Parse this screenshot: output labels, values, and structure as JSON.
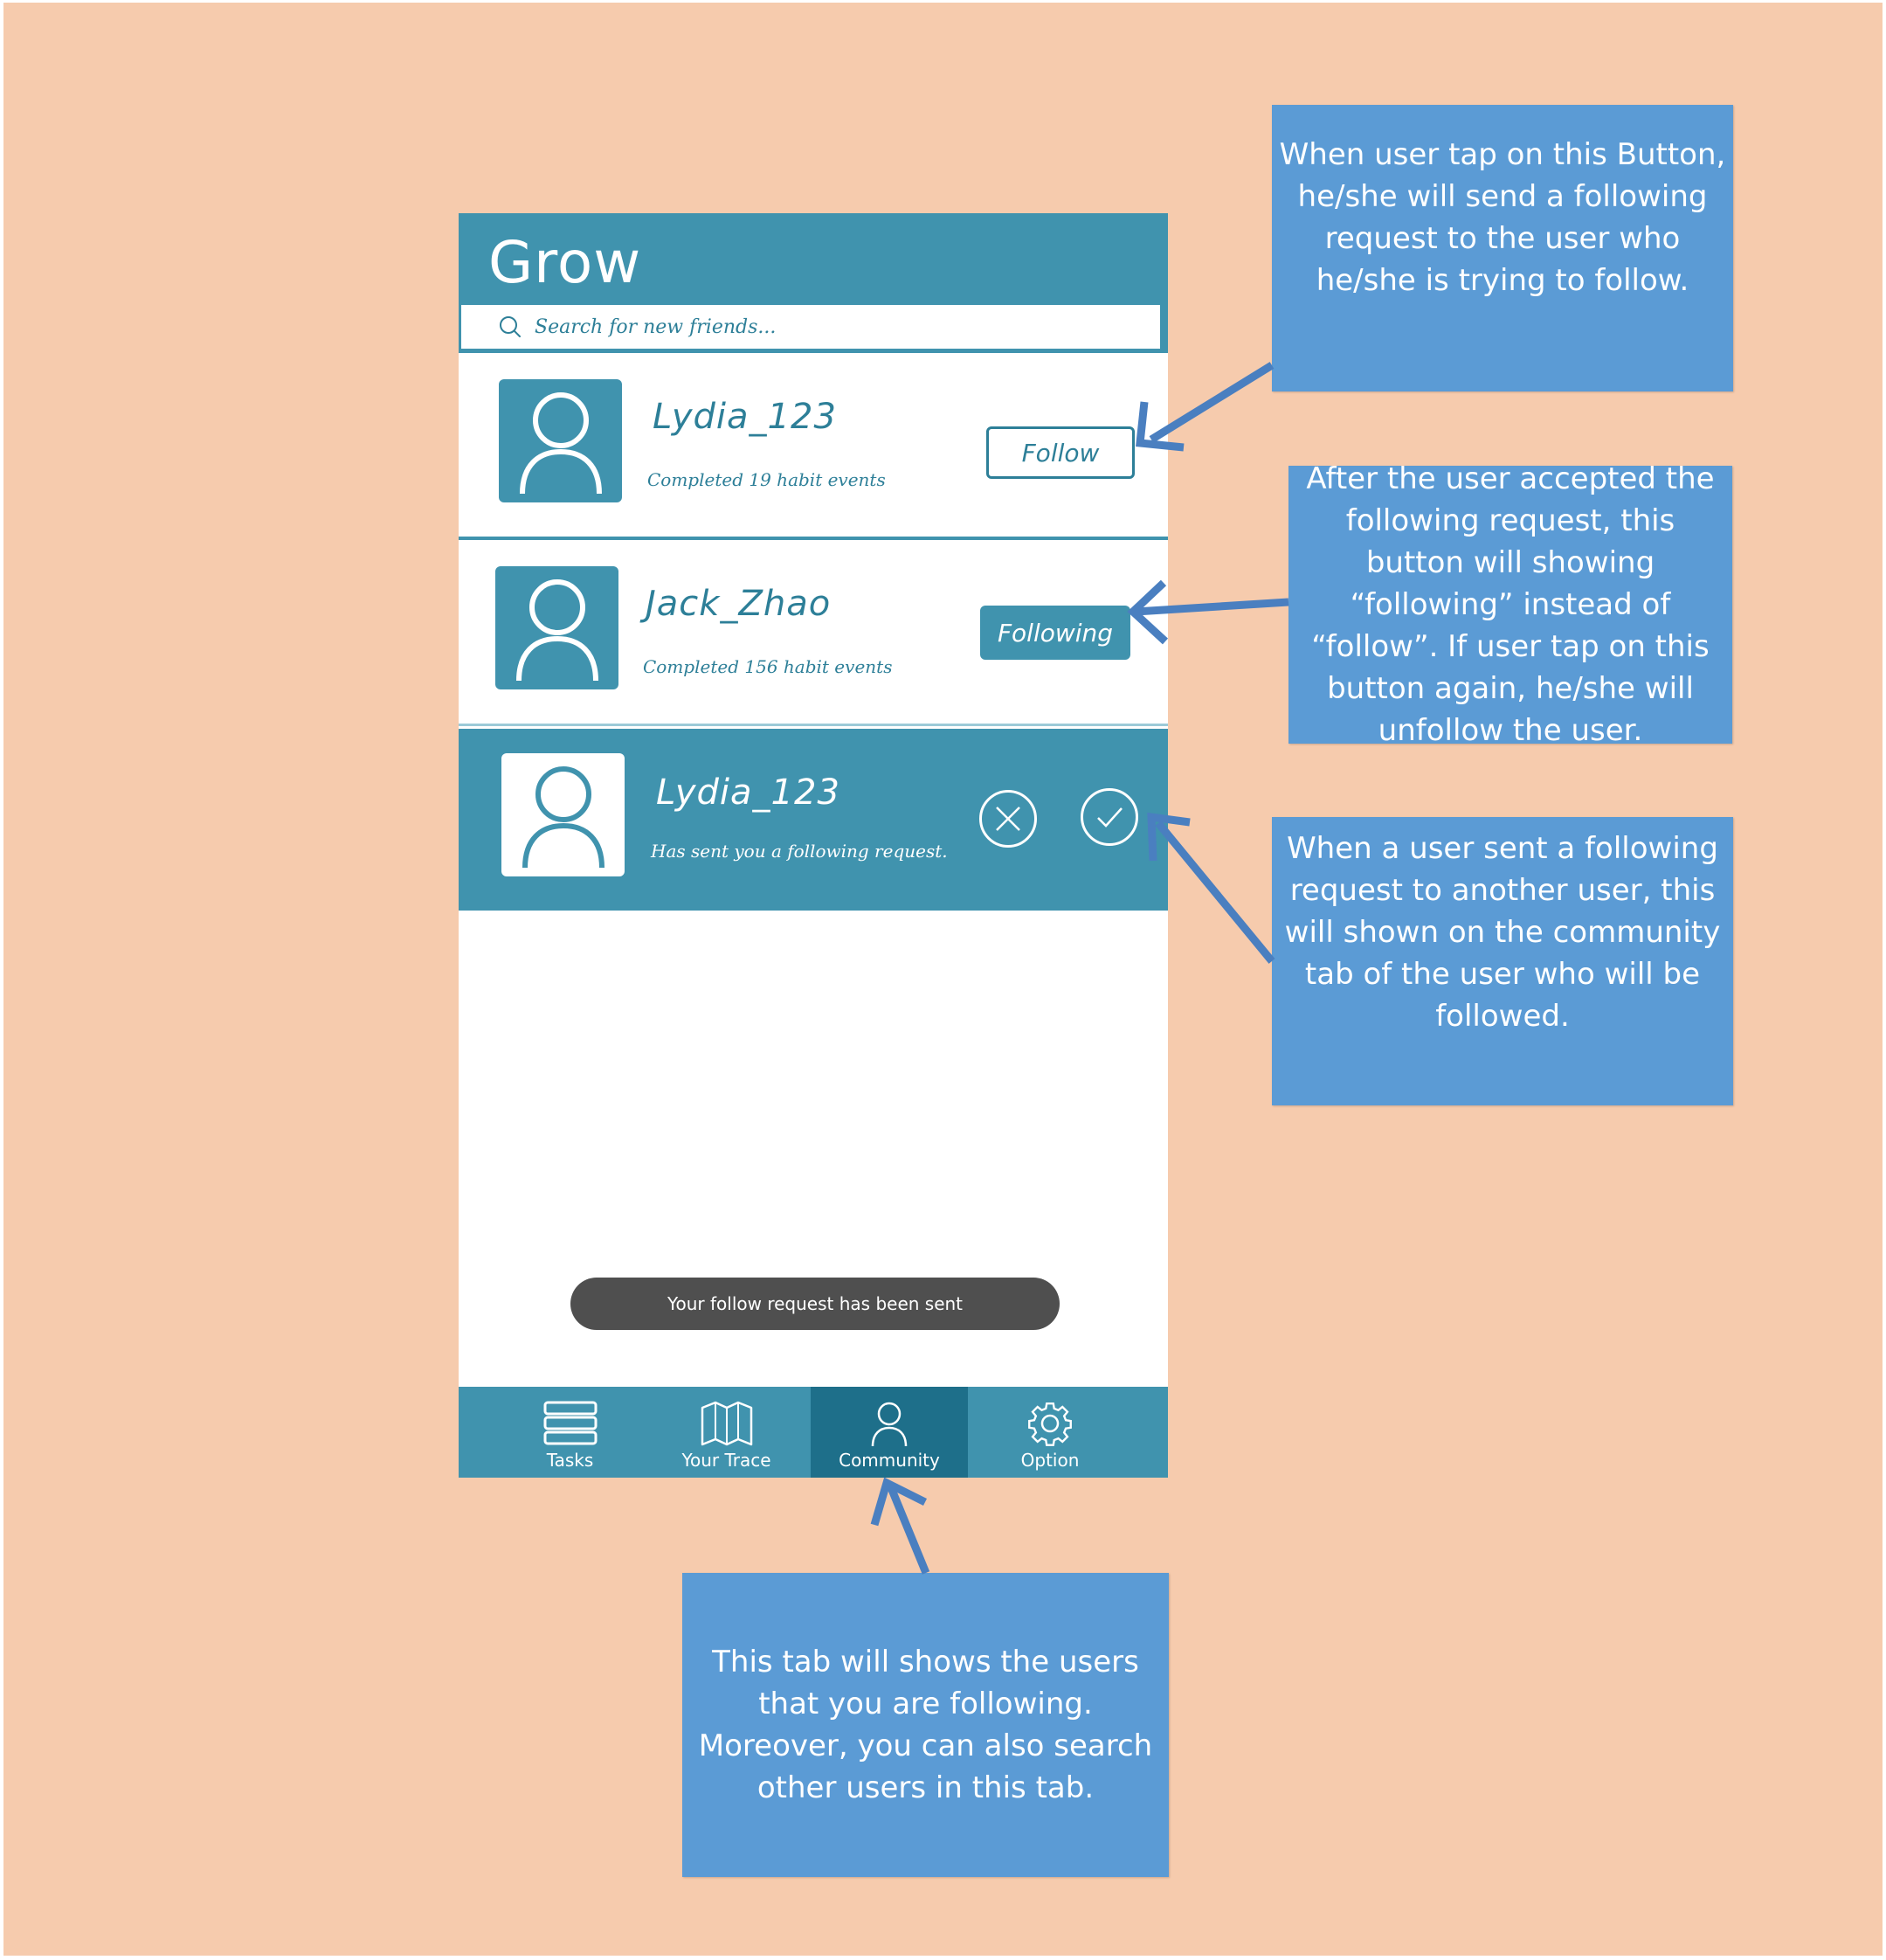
{
  "app": {
    "title": "Grow"
  },
  "search": {
    "placeholder": "Search for new friends..."
  },
  "users": [
    {
      "name": "Lydia_123",
      "subtitle": "Completed 19 habit events",
      "button": "Follow"
    },
    {
      "name": "Jack_Zhao",
      "subtitle": "Completed 156 habit events",
      "button": "Following"
    }
  ],
  "request": {
    "name": "Lydia_123",
    "subtitle": "Has sent you a following request."
  },
  "toast": {
    "text": "Your follow request has been sent"
  },
  "tabs": [
    {
      "label": "Tasks",
      "icon": "stack-icon"
    },
    {
      "label": "Your Trace",
      "icon": "map-icon"
    },
    {
      "label": "Community",
      "icon": "person-icon",
      "active": true
    },
    {
      "label": "Option",
      "icon": "gear-icon"
    }
  ],
  "annotations": {
    "follow_button": "When user tap on this Button, he/she will send a following request to the user who he/she is trying to follow.",
    "following_button": "After the user accepted the following request, this button will showing “following” instead of “follow”. If user tap on this button again, he/she will unfollow the user.",
    "request_row": "When a user sent a following request to another user, this will shown on the community tab of the user who will be followed.",
    "community_tab": "This tab will shows the users that you are following. Moreover, you can also search other users in this tab."
  },
  "colors": {
    "background": "#f6cbad",
    "primary": "#4093ae",
    "active_tab": "#1e6f8a",
    "annotation": "#5b9bd5",
    "toast": "#4f4f4f"
  }
}
